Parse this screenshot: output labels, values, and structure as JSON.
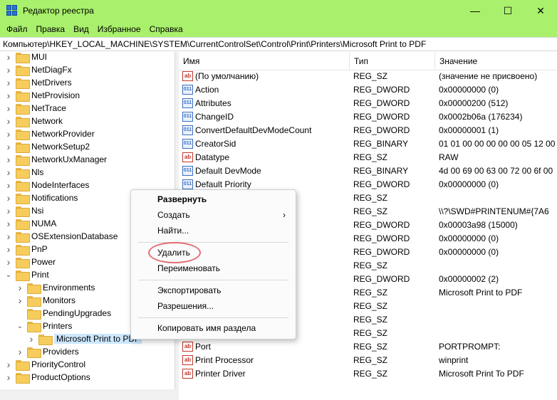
{
  "window": {
    "title": "Редактор реестра"
  },
  "window_buttons": {
    "minimize": "—",
    "maximize": "☐",
    "close": "✕"
  },
  "menu": [
    "Файл",
    "Правка",
    "Вид",
    "Избранное",
    "Справка"
  ],
  "address": "Компьютер\\HKEY_LOCAL_MACHINE\\SYSTEM\\CurrentControlSet\\Control\\Print\\Printers\\Microsoft Print to PDF",
  "tree": [
    {
      "label": "MUI",
      "level": 0,
      "expanded": false
    },
    {
      "label": "NetDiagFx",
      "level": 0,
      "expanded": false
    },
    {
      "label": "NetDrivers",
      "level": 0,
      "expanded": false
    },
    {
      "label": "NetProvision",
      "level": 0,
      "expanded": false
    },
    {
      "label": "NetTrace",
      "level": 0,
      "expanded": false
    },
    {
      "label": "Network",
      "level": 0,
      "expanded": false
    },
    {
      "label": "NetworkProvider",
      "level": 0,
      "expanded": false
    },
    {
      "label": "NetworkSetup2",
      "level": 0,
      "expanded": false
    },
    {
      "label": "NetworkUxManager",
      "level": 0,
      "expanded": false
    },
    {
      "label": "Nls",
      "level": 0,
      "expanded": false
    },
    {
      "label": "NodeInterfaces",
      "level": 0,
      "expanded": false
    },
    {
      "label": "Notifications",
      "level": 0,
      "expanded": false
    },
    {
      "label": "Nsi",
      "level": 0,
      "expanded": false
    },
    {
      "label": "NUMA",
      "level": 0,
      "expanded": false
    },
    {
      "label": "OSExtensionDatabase",
      "level": 0,
      "expanded": false
    },
    {
      "label": "PnP",
      "level": 0,
      "expanded": false
    },
    {
      "label": "Power",
      "level": 0,
      "expanded": false
    },
    {
      "label": "Print",
      "level": 0,
      "expanded": true
    },
    {
      "label": "Environments",
      "level": 1,
      "expanded": false
    },
    {
      "label": "Monitors",
      "level": 1,
      "expanded": false
    },
    {
      "label": "PendingUpgrades",
      "level": 1,
      "leaf": true
    },
    {
      "label": "Printers",
      "level": 1,
      "expanded": true
    },
    {
      "label": "Microsoft Print to PDF",
      "level": 2,
      "expanded": false,
      "selected": true
    },
    {
      "label": "Providers",
      "level": 1,
      "expanded": false
    },
    {
      "label": "PriorityControl",
      "level": 0,
      "expanded": false
    },
    {
      "label": "ProductOptions",
      "level": 0,
      "expanded": false
    }
  ],
  "list_headers": {
    "name": "Имя",
    "type": "Тип",
    "value": "Значение"
  },
  "values": [
    {
      "icon": "str",
      "name": "(По умолчанию)",
      "type": "REG_SZ",
      "value": "(значение не присвоено)"
    },
    {
      "icon": "bin",
      "name": "Action",
      "type": "REG_DWORD",
      "value": "0x00000000 (0)"
    },
    {
      "icon": "bin",
      "name": "Attributes",
      "type": "REG_DWORD",
      "value": "0x00000200 (512)"
    },
    {
      "icon": "bin",
      "name": "ChangeID",
      "type": "REG_DWORD",
      "value": "0x0002b06a (176234)"
    },
    {
      "icon": "bin",
      "name": "ConvertDefaultDevModeCount",
      "type": "REG_DWORD",
      "value": "0x00000001 (1)"
    },
    {
      "icon": "bin",
      "name": "CreatorSid",
      "type": "REG_BINARY",
      "value": "01 01 00 00 00 00 00 05 12 00"
    },
    {
      "icon": "str",
      "name": "Datatype",
      "type": "REG_SZ",
      "value": "RAW"
    },
    {
      "icon": "bin",
      "name": "Default DevMode",
      "type": "REG_BINARY",
      "value": "4d 00 69 00 63 00 72 00 6f 00"
    },
    {
      "icon": "bin",
      "name": "Default Priority",
      "type": "REG_DWORD",
      "value": "0x00000000 (0)"
    },
    {
      "icon": "str",
      "name": "",
      "type": "REG_SZ",
      "value": ""
    },
    {
      "icon": "str",
      "name": "",
      "type": "REG_SZ",
      "value": "\\\\?\\SWD#PRINTENUM#{7A6"
    },
    {
      "icon": "bin",
      "name": "",
      "type": "REG_DWORD",
      "value": "0x00003a98 (15000)"
    },
    {
      "icon": "bin",
      "name": "",
      "type": "REG_DWORD",
      "value": "0x00000000 (0)"
    },
    {
      "icon": "bin",
      "name": "",
      "type": "REG_DWORD",
      "value": "0x00000000 (0)"
    },
    {
      "icon": "str",
      "name": "",
      "type": "REG_SZ",
      "value": ""
    },
    {
      "icon": "bin",
      "name": "",
      "type": "REG_DWORD",
      "value": "0x00000002 (2)"
    },
    {
      "icon": "str",
      "name": "",
      "type": "REG_SZ",
      "value": "Microsoft Print to PDF"
    },
    {
      "icon": "str",
      "name": "",
      "type": "REG_SZ",
      "value": ""
    },
    {
      "icon": "str",
      "name": "",
      "type": "REG_SZ",
      "value": ""
    },
    {
      "icon": "str",
      "name": "",
      "type": "REG_SZ",
      "value": ""
    },
    {
      "icon": "str",
      "name": "Port",
      "type": "REG_SZ",
      "value": "PORTPROMPT:"
    },
    {
      "icon": "str",
      "name": "Print Processor",
      "type": "REG_SZ",
      "value": "winprint"
    },
    {
      "icon": "str",
      "name": "Printer Driver",
      "type": "REG_SZ",
      "value": "Microsoft Print To PDF"
    }
  ],
  "context_menu": {
    "expand": "Развернуть",
    "create": "Создать",
    "find": "Найти...",
    "delete": "Удалить",
    "rename": "Переименовать",
    "export": "Экспортировать",
    "permissions": "Разрешения...",
    "copy_key_name": "Копировать имя раздела"
  },
  "colors": {
    "titlebar": "#a9f06c",
    "selection": "#cce8ff",
    "highlight_ring": "#e36d74"
  }
}
